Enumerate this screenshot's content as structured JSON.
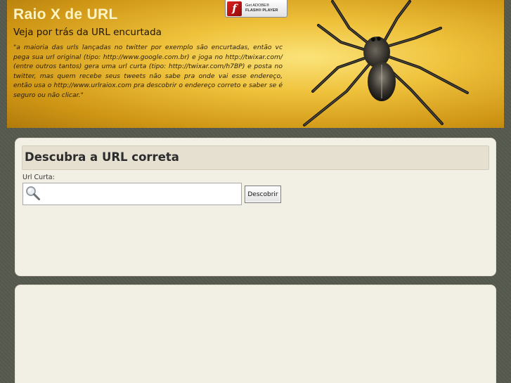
{
  "header": {
    "title": "Raio X de URL",
    "subtitle": "Veja por trás da URL encurtada",
    "intro": "\"a maioria das urls lançadas no twitter por exemplo são encurtadas, então vc pega sua url original (tipo: http://www.google.com.br) e joga no http://twixar.com/ (entre outros tantos) gera uma url curta (tipo: http://twixar.com/h7BP) e posta no twitter, mas quem recebe seus tweets não sabe pra onde vai esse endereço, então usa o http://www.urlraiox.com pra descobrir o endereço correto e saber se é seguro ou não clicar.\""
  },
  "flash_badge": {
    "line1": "Get ADOBE®",
    "line2": "FLASH® PLAYER",
    "icon": "flash-player-icon"
  },
  "main_form": {
    "heading": "Descubra a URL correta",
    "input_label": "Url Curta:",
    "input_value": "",
    "input_icon": "magnifier-icon",
    "submit_label": "Descobrir"
  },
  "colors": {
    "background": "#565a4e",
    "banner": "#efc23c",
    "panel": "#f2efe5",
    "heading_bar": "#e5e0d0"
  }
}
